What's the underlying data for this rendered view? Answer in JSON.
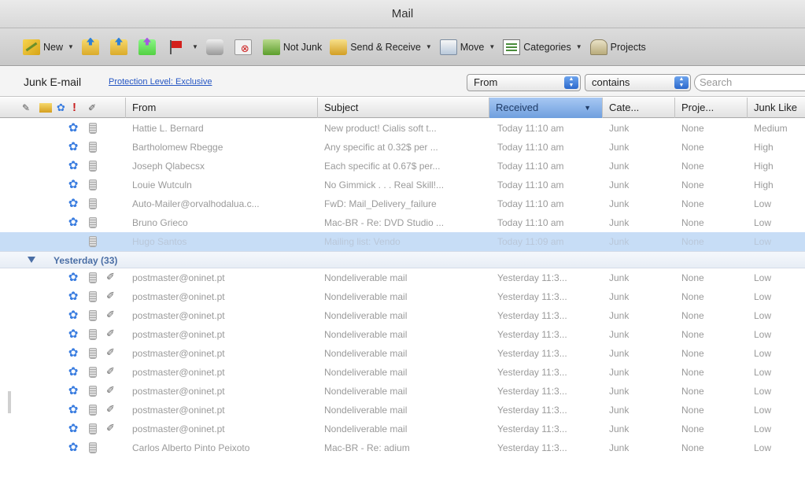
{
  "window": {
    "title": "Mail"
  },
  "toolbar": {
    "new_label": "New",
    "not_junk_label": "Not Junk",
    "send_receive_label": "Send & Receive",
    "move_label": "Move",
    "categories_label": "Categories",
    "projects_label": "Projects",
    "arrow": "▼"
  },
  "filter": {
    "folder_title": "Junk E-mail",
    "protection_link": "Protection Level: Exclusive",
    "field_select": "From",
    "operator_select": "contains",
    "search_placeholder": "Search"
  },
  "columns": {
    "from": "From",
    "subject": "Subject",
    "received": "Received",
    "categories": "Cate...",
    "projects": "Proje...",
    "junk": "Junk Like"
  },
  "group_yesterday": {
    "label": "Yesterday (33)"
  },
  "messages_today": [
    {
      "from": "Hattie L. Bernard",
      "subject": "New product! Cialis soft t...",
      "received": "Today 11:10 am",
      "category": "Junk",
      "project": "None",
      "junk": "Medium"
    },
    {
      "from": "Bartholomew Rbegge",
      "subject": "Any specific at 0.32$ per ...",
      "received": "Today 11:10 am",
      "category": "Junk",
      "project": "None",
      "junk": "High"
    },
    {
      "from": "Joseph Qlabecsx",
      "subject": "Each specific at 0.67$ per...",
      "received": "Today 11:10 am",
      "category": "Junk",
      "project": "None",
      "junk": "High"
    },
    {
      "from": "Louie Wutculn",
      "subject": "No Gimmick . . . Real Skill!...",
      "received": "Today 11:10 am",
      "category": "Junk",
      "project": "None",
      "junk": "High"
    },
    {
      "from": "Auto-Mailer@orvalhodalua.c...",
      "subject": "FwD: Mail_Delivery_failure",
      "received": "Today 11:10 am",
      "category": "Junk",
      "project": "None",
      "junk": "Low"
    },
    {
      "from": "Bruno Grieco",
      "subject": "Mac-BR - Re: DVD Studio ...",
      "received": "Today 11:10 am",
      "category": "Junk",
      "project": "None",
      "junk": "Low"
    },
    {
      "from": "Hugo Santos",
      "subject": "Mailing list: Vendo",
      "received": "Today 11:09 am",
      "category": "Junk",
      "project": "None",
      "junk": "Low"
    }
  ],
  "messages_yesterday": [
    {
      "from": "postmaster@oninet.pt",
      "subject": "Nondeliverable mail",
      "received": "Yesterday 11:3...",
      "category": "Junk",
      "project": "None",
      "junk": "Low"
    },
    {
      "from": "postmaster@oninet.pt",
      "subject": "Nondeliverable mail",
      "received": "Yesterday 11:3...",
      "category": "Junk",
      "project": "None",
      "junk": "Low"
    },
    {
      "from": "postmaster@oninet.pt",
      "subject": "Nondeliverable mail",
      "received": "Yesterday 11:3...",
      "category": "Junk",
      "project": "None",
      "junk": "Low"
    },
    {
      "from": "postmaster@oninet.pt",
      "subject": "Nondeliverable mail",
      "received": "Yesterday 11:3...",
      "category": "Junk",
      "project": "None",
      "junk": "Low"
    },
    {
      "from": "postmaster@oninet.pt",
      "subject": "Nondeliverable mail",
      "received": "Yesterday 11:3...",
      "category": "Junk",
      "project": "None",
      "junk": "Low"
    },
    {
      "from": "postmaster@oninet.pt",
      "subject": "Nondeliverable mail",
      "received": "Yesterday 11:3...",
      "category": "Junk",
      "project": "None",
      "junk": "Low"
    },
    {
      "from": "postmaster@oninet.pt",
      "subject": "Nondeliverable mail",
      "received": "Yesterday 11:3...",
      "category": "Junk",
      "project": "None",
      "junk": "Low"
    },
    {
      "from": "postmaster@oninet.pt",
      "subject": "Nondeliverable mail",
      "received": "Yesterday 11:3...",
      "category": "Junk",
      "project": "None",
      "junk": "Low"
    },
    {
      "from": "postmaster@oninet.pt",
      "subject": "Nondeliverable mail",
      "received": "Yesterday 11:3...",
      "category": "Junk",
      "project": "None",
      "junk": "Low"
    },
    {
      "from": "Carlos Alberto Pinto Peixoto",
      "subject": "Mac-BR - Re: adium",
      "received": "Yesterday 11:3...",
      "category": "Junk",
      "project": "None",
      "junk": "Low"
    }
  ]
}
